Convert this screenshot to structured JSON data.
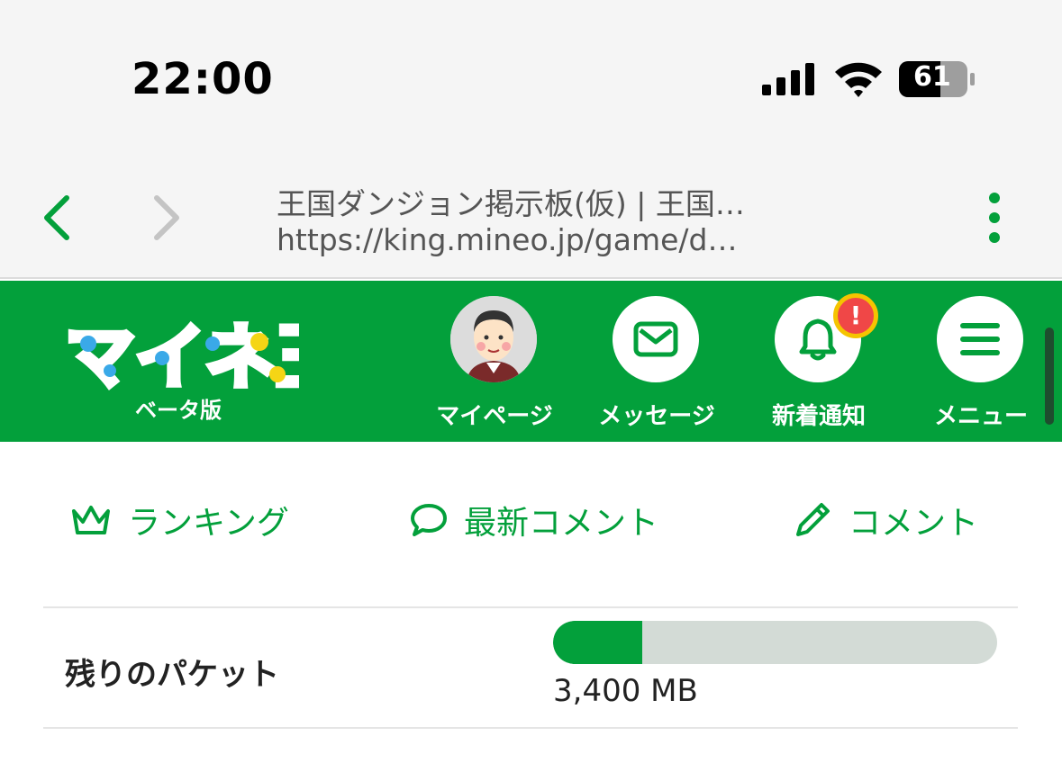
{
  "status_bar": {
    "time": "22:00",
    "battery": "61"
  },
  "browser": {
    "page_title": "王国ダンジョン掲示板(仮) | 王国…",
    "url": "https://king.mineo.jp/game/d…"
  },
  "header": {
    "logo_text": "マイネ王",
    "logo_subtitle": "ベータ版",
    "nav": [
      {
        "label": "マイページ",
        "icon": "avatar"
      },
      {
        "label": "メッセージ",
        "icon": "mail-icon"
      },
      {
        "label": "新着通知",
        "icon": "bell-icon",
        "badge": "!"
      },
      {
        "label": "メニュー",
        "icon": "hamburger-icon"
      }
    ]
  },
  "subnav": [
    {
      "label": "ランキング",
      "icon": "crown-icon"
    },
    {
      "label": "最新コメント",
      "icon": "speech-bubble-icon"
    },
    {
      "label": "コメント",
      "icon": "pencil-icon"
    }
  ],
  "packet": {
    "label": "残りのパケット",
    "value": "3,400 MB",
    "fill_fraction": 0.2
  },
  "colors": {
    "brand_green": "#03a03b",
    "bar_track": "#d3dbd6",
    "badge_red": "#f04747",
    "badge_ring": "#f5c400"
  }
}
